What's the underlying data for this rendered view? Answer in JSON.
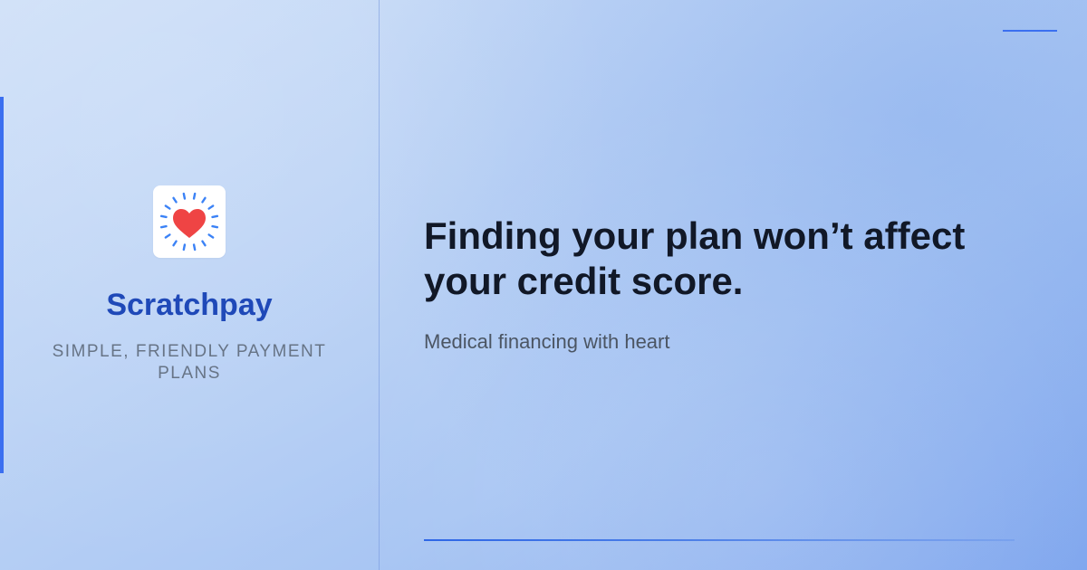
{
  "brand": {
    "name": "Scratchpay",
    "tagline": "SIMPLE, FRIENDLY PAYMENT PLANS",
    "logo_icon": "heart-icon",
    "heart_color": "#ef4444",
    "ray_color": "#3b82f6"
  },
  "headline": {
    "line1": "Finding your plan won’t affect",
    "line2": "your credit score."
  },
  "subhead": "Medical financing with heart",
  "colors": {
    "accent": "#3b6ff0",
    "brand_text": "#1f49b8",
    "headline": "#111827",
    "subhead": "#4b5563",
    "tagline": "#677486"
  }
}
